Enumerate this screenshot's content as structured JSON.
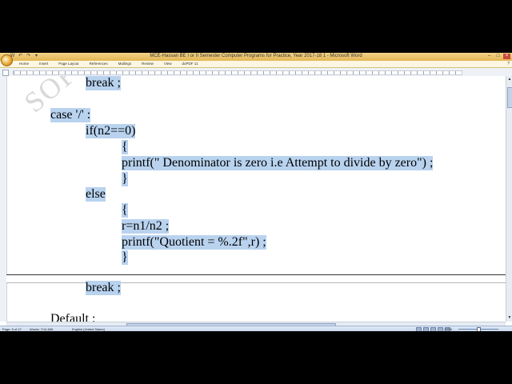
{
  "window": {
    "title": "MCE-Hassan BE I or II Semester Computer Programs for Practice, Year 2017-18 1 - Microsoft Word",
    "controls": [
      "–",
      "□",
      "×"
    ],
    "quick_access": [
      "W",
      "↶",
      "↷",
      "▾"
    ]
  },
  "ribbon": {
    "tabs": [
      "Home",
      "Insert",
      "Page Layout",
      "References",
      "Mailings",
      "Review",
      "View",
      "doPDF 11"
    ],
    "help": "?"
  },
  "document": {
    "watermark": "SOFT",
    "lines": [
      "break ;",
      "case '/' :",
      "if(n2==0)",
      "{",
      "printf(\" Denominator is zero i.e Attempt to divide by zero\") ;",
      "}",
      "else",
      "{",
      "r=n1/n2 ;",
      "printf(\"Quotient = %.2f\",r) ;",
      "}",
      "break ;",
      "Default :"
    ]
  },
  "status_bar": {
    "page": "Page: 5 of 47",
    "words": "Words: 7/14,606",
    "language": "English (United States)",
    "zoom": "170%"
  },
  "colors": {
    "selection": "#b9d3ef",
    "title_bar": "#e3b552",
    "status_bar": "#c6d6ec"
  }
}
